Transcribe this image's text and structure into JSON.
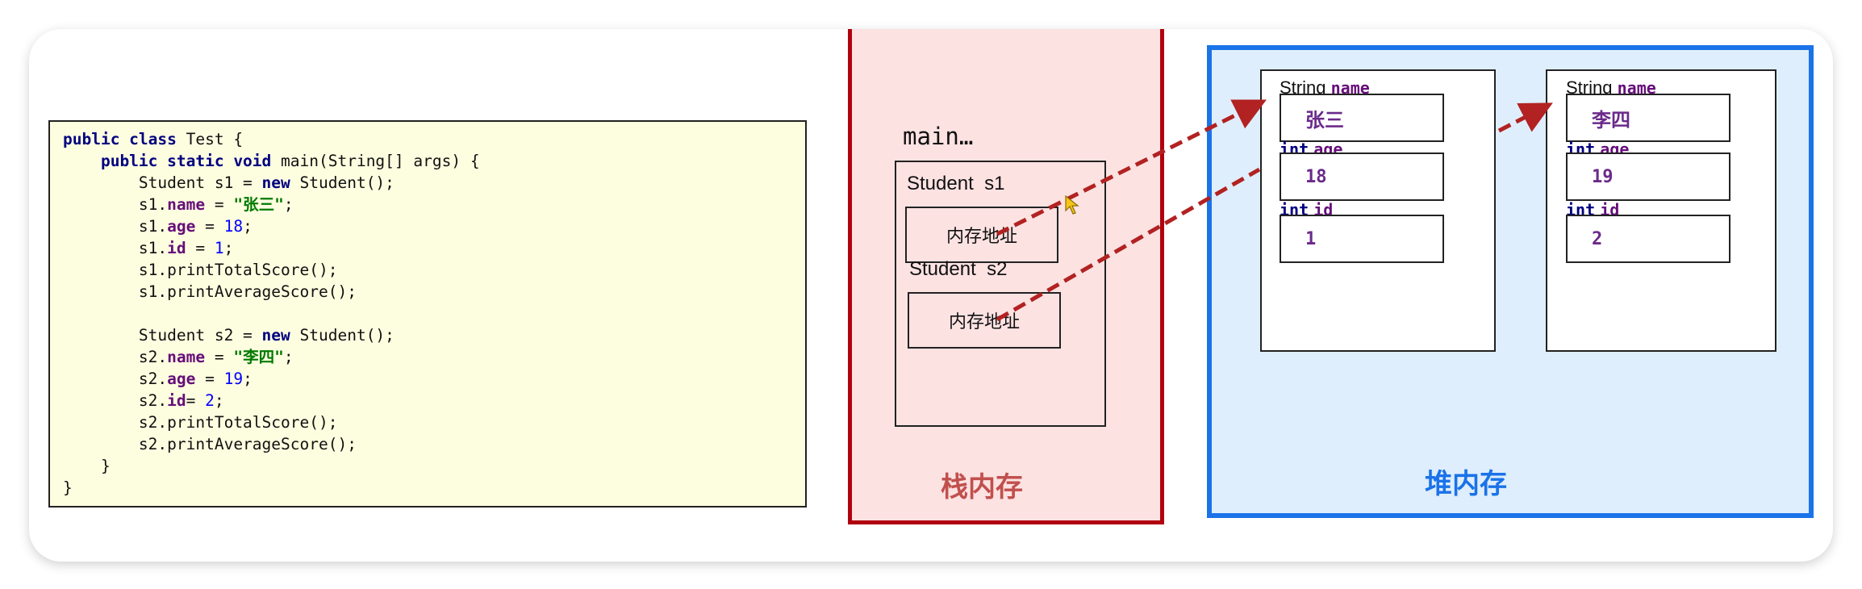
{
  "heading_fragment": "",
  "code": {
    "lines": [
      [
        {
          "t": "public class ",
          "c": "kw"
        },
        {
          "t": "Test {",
          "c": ""
        }
      ],
      [
        {
          "t": "    public static void ",
          "c": "kw"
        },
        {
          "t": "main(String[] args) {",
          "c": ""
        }
      ],
      [
        {
          "t": "        Student s1 = ",
          "c": ""
        },
        {
          "t": "new ",
          "c": "kw"
        },
        {
          "t": "Student();",
          "c": ""
        }
      ],
      [
        {
          "t": "        s1.",
          "c": ""
        },
        {
          "t": "name",
          "c": "fld"
        },
        {
          "t": " = ",
          "c": ""
        },
        {
          "t": "\"张三\"",
          "c": "str"
        },
        {
          "t": ";",
          "c": ""
        }
      ],
      [
        {
          "t": "        s1.",
          "c": ""
        },
        {
          "t": "age",
          "c": "fld"
        },
        {
          "t": " = ",
          "c": ""
        },
        {
          "t": "18",
          "c": "num"
        },
        {
          "t": ";",
          "c": ""
        }
      ],
      [
        {
          "t": "        s1.",
          "c": ""
        },
        {
          "t": "id",
          "c": "fld"
        },
        {
          "t": " = ",
          "c": ""
        },
        {
          "t": "1",
          "c": "num"
        },
        {
          "t": ";",
          "c": ""
        }
      ],
      [
        {
          "t": "        s1.printTotalScore();",
          "c": ""
        }
      ],
      [
        {
          "t": "        s1.printAverageScore();",
          "c": ""
        }
      ],
      [
        {
          "t": "",
          "c": ""
        }
      ],
      [
        {
          "t": "        Student s2 = ",
          "c": ""
        },
        {
          "t": "new ",
          "c": "kw"
        },
        {
          "t": "Student();",
          "c": ""
        }
      ],
      [
        {
          "t": "        s2.",
          "c": ""
        },
        {
          "t": "name",
          "c": "fld"
        },
        {
          "t": " = ",
          "c": ""
        },
        {
          "t": "\"李四\"",
          "c": "str"
        },
        {
          "t": ";",
          "c": ""
        }
      ],
      [
        {
          "t": "        s2.",
          "c": ""
        },
        {
          "t": "age",
          "c": "fld"
        },
        {
          "t": " = ",
          "c": ""
        },
        {
          "t": "19",
          "c": "num"
        },
        {
          "t": ";",
          "c": ""
        }
      ],
      [
        {
          "t": "        s2.",
          "c": ""
        },
        {
          "t": "id",
          "c": "fld"
        },
        {
          "t": "= ",
          "c": ""
        },
        {
          "t": "2",
          "c": "num"
        },
        {
          "t": ";",
          "c": ""
        }
      ],
      [
        {
          "t": "        s2.printTotalScore();",
          "c": ""
        }
      ],
      [
        {
          "t": "        s2.printAverageScore();",
          "c": ""
        }
      ],
      [
        {
          "t": "    }",
          "c": ""
        }
      ],
      [
        {
          "t": "}",
          "c": ""
        }
      ]
    ]
  },
  "stack": {
    "title": "栈内存",
    "frame_label": "main…",
    "vars": [
      {
        "type": "Student",
        "name": "s1",
        "value": "内存地址"
      },
      {
        "type": "Student",
        "name": "s2",
        "value": "内存地址"
      }
    ]
  },
  "heap": {
    "title": "堆内存",
    "objects": [
      {
        "fields": [
          {
            "type": "String",
            "name": "name",
            "value": "张三"
          },
          {
            "type": "int",
            "name": "age",
            "value": "18"
          },
          {
            "type": "int",
            "name": "id",
            "value": "1"
          }
        ]
      },
      {
        "fields": [
          {
            "type": "String",
            "name": "name",
            "value": "李四"
          },
          {
            "type": "int",
            "name": "age",
            "value": "19"
          },
          {
            "type": "int",
            "name": "id",
            "value": "2"
          }
        ]
      }
    ]
  },
  "colors": {
    "stack_border": "#b0000f",
    "stack_fill": "#fde2e2",
    "stack_title": "#c0504d",
    "heap_border": "#1a73e8",
    "heap_fill": "#dfeefc",
    "arrow": "#b22222",
    "code_bg": "#fdfde0"
  },
  "icons": {
    "cursor": "mouse-pointer-icon"
  }
}
